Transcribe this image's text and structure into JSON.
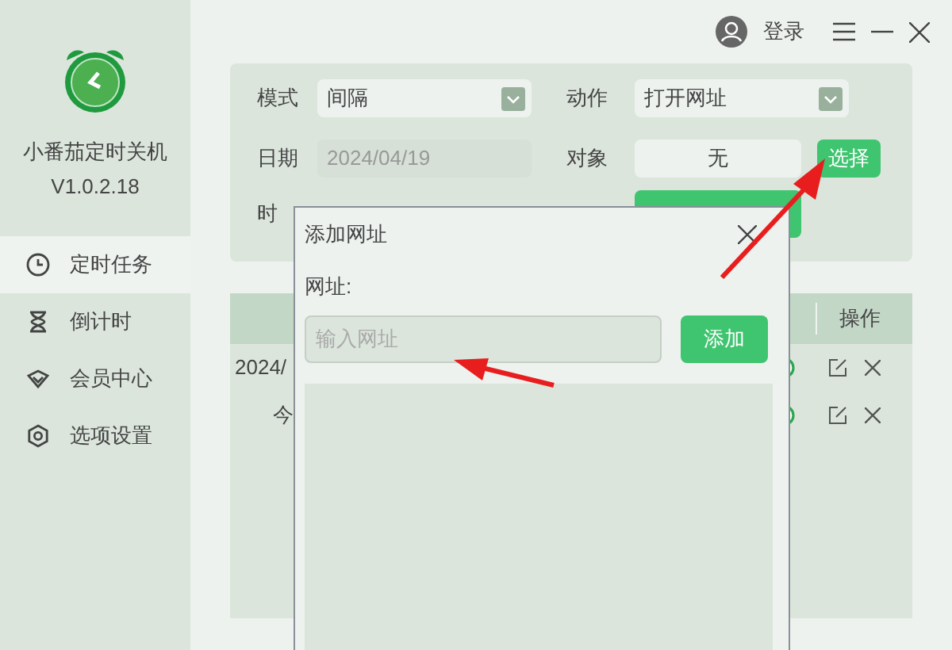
{
  "app": {
    "name": "小番茄定时关机",
    "version": "V1.0.2.18"
  },
  "sidebar": {
    "items": [
      {
        "label": "定时任务",
        "selected": true
      },
      {
        "label": "倒计时",
        "selected": false
      },
      {
        "label": "会员中心",
        "selected": false
      },
      {
        "label": "选项设置",
        "selected": false
      }
    ]
  },
  "header": {
    "login": "登录"
  },
  "form": {
    "mode_label": "模式",
    "mode_value": "间隔",
    "date_label": "日期",
    "date_value": "2024/04/19",
    "time_label": "时",
    "action_label": "动作",
    "action_value": "打开网址",
    "target_label": "对象",
    "target_value": "无",
    "select_button": "选择"
  },
  "table": {
    "columns": [
      {
        "label": "操作"
      }
    ],
    "rows": [
      {
        "cell": "2024/"
      },
      {
        "cell": "今"
      }
    ]
  },
  "dialog": {
    "title": "添加网址",
    "url_label": "网址:",
    "url_placeholder": "输入网址",
    "add_button": "添加"
  }
}
